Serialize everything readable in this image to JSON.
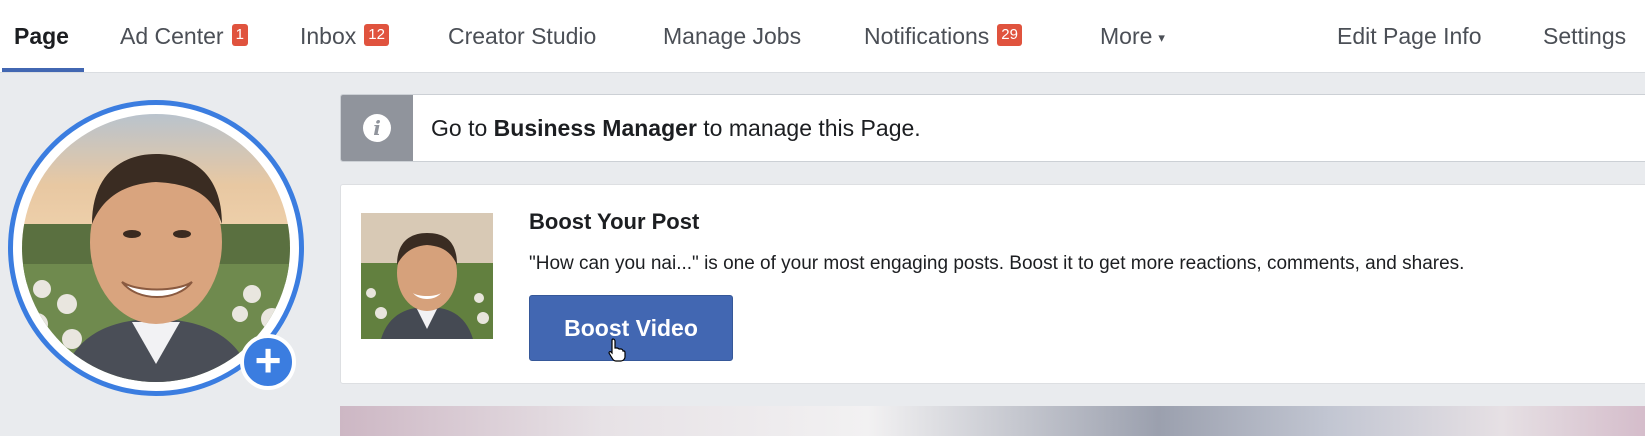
{
  "nav": {
    "tabs": [
      {
        "label": "Page",
        "badge": null,
        "active": true
      },
      {
        "label": "Ad Center",
        "badge": "1"
      },
      {
        "label": "Inbox",
        "badge": "12"
      },
      {
        "label": "Creator Studio",
        "badge": null
      },
      {
        "label": "Manage Jobs",
        "badge": null
      },
      {
        "label": "Notifications",
        "badge": "29"
      },
      {
        "label": "More",
        "badge": null,
        "caret": "▾"
      }
    ],
    "right_tabs": [
      {
        "label": "Edit Page Info"
      },
      {
        "label": "Settings"
      }
    ]
  },
  "profile": {
    "add_icon": "plus-icon",
    "add_symbol": "+"
  },
  "banner": {
    "icon": "info-icon",
    "icon_symbol": "i",
    "text_before": "Go to ",
    "text_bold": "Business Manager",
    "text_after": " to manage this Page."
  },
  "boost_card": {
    "title": "Boost Your Post",
    "description": "\"How can you nai...\" is one of your most engaging posts. Boost it to get more reactions, comments, and shares.",
    "button_label": "Boost Video"
  },
  "colors": {
    "accent": "#4267b2",
    "ring": "#3b7de0",
    "badge": "#e0533e",
    "banner_icon_bg": "#90949c"
  }
}
